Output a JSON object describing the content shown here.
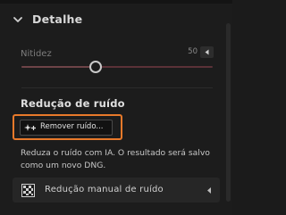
{
  "detail": {
    "section_title": "Detalhe",
    "expand_icon": "chevron-down-icon"
  },
  "sharpness": {
    "label": "Nitidez",
    "value": "50",
    "fraction": 0.39,
    "arrow_icon": "triangle-left-icon"
  },
  "noise_reduction": {
    "title": "Redução de ruído",
    "remove_button_label": "Remover ruído...",
    "remove_button_icon": "sparkle-plus-icon",
    "description": "Reduza o ruído com IA. O resultado será salvo como um novo DNG.",
    "highlight_color": "#e8792a"
  },
  "manual_noise_reduction": {
    "label": "Redução manual de ruído",
    "icon": "noise-pattern-icon",
    "arrow_icon": "triangle-left-icon"
  }
}
